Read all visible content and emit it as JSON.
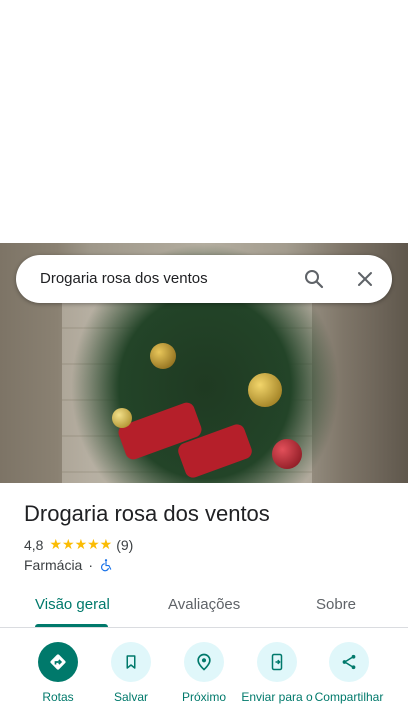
{
  "search": {
    "query": "Drogaria rosa dos ventos"
  },
  "place": {
    "name": "Drogaria rosa dos ventos",
    "rating": "4,8",
    "stars": "★★★★★",
    "review_count": "(9)",
    "category": "Farmácia",
    "separator": "·"
  },
  "tabs": [
    {
      "label": "Visão geral",
      "active": true
    },
    {
      "label": "Avaliações",
      "active": false
    },
    {
      "label": "Sobre",
      "active": false
    }
  ],
  "actions": [
    {
      "label": "Rotas",
      "icon": "directions-icon"
    },
    {
      "label": "Salvar",
      "icon": "bookmark-icon"
    },
    {
      "label": "Próximo",
      "icon": "nearby-icon"
    },
    {
      "label": "Enviar para o",
      "icon": "send-to-phone-icon"
    },
    {
      "label": "Compartilhar",
      "icon": "share-icon"
    }
  ],
  "colors": {
    "accent": "#00796b",
    "accent_light": "#e0f7fa",
    "star": "#fbbc04"
  }
}
